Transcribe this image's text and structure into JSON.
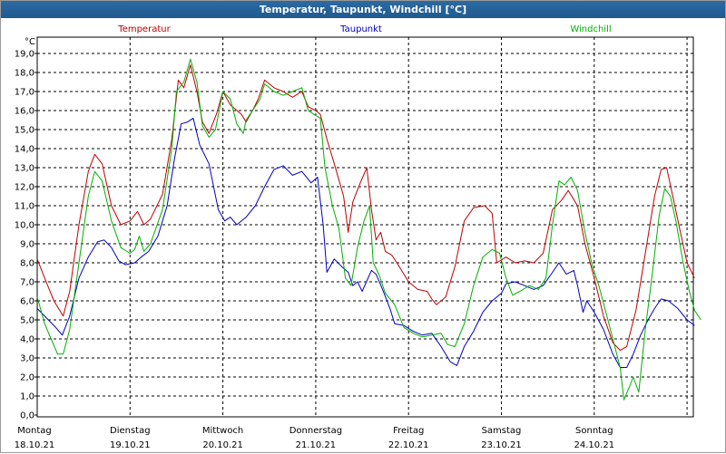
{
  "window": {
    "title": "Temperatur, Taupunkt, Windchill [°C]"
  },
  "chart_data": {
    "type": "line",
    "title": "Temperatur, Taupunkt, Windchill [°C]",
    "ylabel": "°C",
    "ylim": [
      0,
      19.5
    ],
    "xlim": [
      0,
      7
    ],
    "grid": true,
    "legend": "top",
    "yticks": [
      "0,0",
      "1,0",
      "2,0",
      "3,0",
      "4,0",
      "5,0",
      "6,0",
      "7,0",
      "8,0",
      "9,0",
      "10,0",
      "11,0",
      "12,0",
      "13,0",
      "14,0",
      "15,0",
      "16,0",
      "17,0",
      "18,0",
      "19,0"
    ],
    "xticks": [
      {
        "day": "Montag",
        "date": "18.10.21"
      },
      {
        "day": "Dienstag",
        "date": "19.10.21"
      },
      {
        "day": "Mittwoch",
        "date": "20.10.21"
      },
      {
        "day": "Donnerstag",
        "date": "21.10.21"
      },
      {
        "day": "Freitag",
        "date": "22.10.21"
      },
      {
        "day": "Samstag",
        "date": "23.10.21"
      },
      {
        "day": "Sonntag",
        "date": "24.10.21"
      }
    ],
    "series": [
      {
        "name": "Temperatur",
        "color": "#c00000",
        "points": [
          [
            0.0,
            8.2
          ],
          [
            0.08,
            7.2
          ],
          [
            0.18,
            6.0
          ],
          [
            0.28,
            5.2
          ],
          [
            0.35,
            6.5
          ],
          [
            0.45,
            10.0
          ],
          [
            0.55,
            12.8
          ],
          [
            0.62,
            13.7
          ],
          [
            0.7,
            13.2
          ],
          [
            0.8,
            11.0
          ],
          [
            0.9,
            10.0
          ],
          [
            1.0,
            10.2
          ],
          [
            1.08,
            10.7
          ],
          [
            1.15,
            10.0
          ],
          [
            1.22,
            10.3
          ],
          [
            1.35,
            11.6
          ],
          [
            1.45,
            14.5
          ],
          [
            1.52,
            17.6
          ],
          [
            1.58,
            17.2
          ],
          [
            1.65,
            18.4
          ],
          [
            1.72,
            17.0
          ],
          [
            1.78,
            15.4
          ],
          [
            1.85,
            14.8
          ],
          [
            1.93,
            15.8
          ],
          [
            2.0,
            17.0
          ],
          [
            2.08,
            16.3
          ],
          [
            2.2,
            15.8
          ],
          [
            2.25,
            15.4
          ],
          [
            2.32,
            16.0
          ],
          [
            2.38,
            16.6
          ],
          [
            2.45,
            17.6
          ],
          [
            2.55,
            17.2
          ],
          [
            2.65,
            17.0
          ],
          [
            2.75,
            16.7
          ],
          [
            2.85,
            17.0
          ],
          [
            2.92,
            16.2
          ],
          [
            3.0,
            16.0
          ],
          [
            3.05,
            15.8
          ],
          [
            3.12,
            14.5
          ],
          [
            3.2,
            13.2
          ],
          [
            3.3,
            11.5
          ],
          [
            3.35,
            9.6
          ],
          [
            3.4,
            11.2
          ],
          [
            3.48,
            12.2
          ],
          [
            3.55,
            13.0
          ],
          [
            3.6,
            10.8
          ],
          [
            3.65,
            9.2
          ],
          [
            3.7,
            9.6
          ],
          [
            3.75,
            8.6
          ],
          [
            3.82,
            8.4
          ],
          [
            3.9,
            7.8
          ],
          [
            4.0,
            7.0
          ],
          [
            4.1,
            6.6
          ],
          [
            4.2,
            6.5
          ],
          [
            4.25,
            6.1
          ],
          [
            4.3,
            5.8
          ],
          [
            4.4,
            6.2
          ],
          [
            4.5,
            7.8
          ],
          [
            4.6,
            10.2
          ],
          [
            4.7,
            10.9
          ],
          [
            4.82,
            11.0
          ],
          [
            4.9,
            10.6
          ],
          [
            4.95,
            8.0
          ],
          [
            5.05,
            8.3
          ],
          [
            5.15,
            8.0
          ],
          [
            5.25,
            8.1
          ],
          [
            5.35,
            8.0
          ],
          [
            5.45,
            8.5
          ],
          [
            5.55,
            10.8
          ],
          [
            5.65,
            11.3
          ],
          [
            5.72,
            11.8
          ],
          [
            5.82,
            11.0
          ],
          [
            5.9,
            9.0
          ],
          [
            6.0,
            7.2
          ],
          [
            6.1,
            5.2
          ],
          [
            6.2,
            3.8
          ],
          [
            6.28,
            3.4
          ],
          [
            6.35,
            3.6
          ],
          [
            6.45,
            5.5
          ],
          [
            6.55,
            8.5
          ],
          [
            6.65,
            11.5
          ],
          [
            6.72,
            12.9
          ],
          [
            6.78,
            13.0
          ],
          [
            6.85,
            11.4
          ],
          [
            6.92,
            9.8
          ],
          [
            7.0,
            8.0
          ],
          [
            7.08,
            7.2
          ]
        ]
      },
      {
        "name": "Taupunkt",
        "color": "#0000c0",
        "points": [
          [
            0.0,
            5.6
          ],
          [
            0.1,
            5.1
          ],
          [
            0.2,
            4.6
          ],
          [
            0.27,
            4.2
          ],
          [
            0.35,
            5.2
          ],
          [
            0.45,
            7.2
          ],
          [
            0.55,
            8.3
          ],
          [
            0.65,
            9.1
          ],
          [
            0.72,
            9.2
          ],
          [
            0.8,
            8.8
          ],
          [
            0.88,
            8.1
          ],
          [
            0.95,
            7.9
          ],
          [
            1.05,
            8.0
          ],
          [
            1.12,
            8.3
          ],
          [
            1.2,
            8.6
          ],
          [
            1.3,
            9.4
          ],
          [
            1.4,
            11.0
          ],
          [
            1.48,
            13.5
          ],
          [
            1.55,
            15.3
          ],
          [
            1.62,
            15.4
          ],
          [
            1.68,
            15.6
          ],
          [
            1.75,
            14.2
          ],
          [
            1.85,
            13.2
          ],
          [
            1.95,
            10.8
          ],
          [
            2.02,
            10.2
          ],
          [
            2.08,
            10.4
          ],
          [
            2.15,
            10.0
          ],
          [
            2.25,
            10.4
          ],
          [
            2.35,
            11.0
          ],
          [
            2.45,
            12.0
          ],
          [
            2.55,
            12.9
          ],
          [
            2.65,
            13.1
          ],
          [
            2.75,
            12.6
          ],
          [
            2.85,
            12.8
          ],
          [
            2.95,
            12.2
          ],
          [
            3.02,
            12.5
          ],
          [
            3.08,
            10.0
          ],
          [
            3.12,
            7.5
          ],
          [
            3.2,
            8.2
          ],
          [
            3.28,
            7.8
          ],
          [
            3.35,
            7.5
          ],
          [
            3.4,
            6.8
          ],
          [
            3.45,
            7.0
          ],
          [
            3.5,
            6.5
          ],
          [
            3.6,
            7.6
          ],
          [
            3.65,
            7.4
          ],
          [
            3.72,
            6.6
          ],
          [
            3.8,
            5.6
          ],
          [
            3.85,
            4.8
          ],
          [
            3.95,
            4.7
          ],
          [
            4.05,
            4.4
          ],
          [
            4.15,
            4.2
          ],
          [
            4.25,
            4.3
          ],
          [
            4.35,
            3.6
          ],
          [
            4.45,
            2.8
          ],
          [
            4.52,
            2.6
          ],
          [
            4.6,
            3.6
          ],
          [
            4.7,
            4.4
          ],
          [
            4.8,
            5.4
          ],
          [
            4.9,
            6.0
          ],
          [
            5.0,
            6.4
          ],
          [
            5.05,
            6.9
          ],
          [
            5.15,
            7.0
          ],
          [
            5.25,
            6.8
          ],
          [
            5.35,
            6.6
          ],
          [
            5.45,
            6.8
          ],
          [
            5.55,
            7.5
          ],
          [
            5.62,
            8.0
          ],
          [
            5.7,
            7.4
          ],
          [
            5.78,
            7.6
          ],
          [
            5.82,
            6.8
          ],
          [
            5.88,
            5.4
          ],
          [
            5.92,
            6.0
          ],
          [
            6.0,
            5.4
          ],
          [
            6.1,
            4.5
          ],
          [
            6.2,
            3.2
          ],
          [
            6.28,
            2.5
          ],
          [
            6.35,
            2.5
          ],
          [
            6.42,
            3.2
          ],
          [
            6.5,
            4.2
          ],
          [
            6.58,
            5.0
          ],
          [
            6.65,
            5.6
          ],
          [
            6.72,
            6.1
          ],
          [
            6.8,
            6.0
          ],
          [
            6.9,
            5.6
          ],
          [
            7.0,
            5.0
          ],
          [
            7.08,
            4.7
          ]
        ]
      },
      {
        "name": "Windchill",
        "color": "#00b000",
        "points": [
          [
            0.0,
            6.2
          ],
          [
            0.08,
            4.8
          ],
          [
            0.15,
            4.0
          ],
          [
            0.22,
            3.2
          ],
          [
            0.28,
            3.2
          ],
          [
            0.35,
            4.5
          ],
          [
            0.45,
            8.0
          ],
          [
            0.55,
            11.5
          ],
          [
            0.62,
            12.8
          ],
          [
            0.7,
            12.3
          ],
          [
            0.8,
            10.2
          ],
          [
            0.9,
            8.8
          ],
          [
            1.0,
            8.5
          ],
          [
            1.05,
            8.7
          ],
          [
            1.1,
            9.4
          ],
          [
            1.15,
            8.6
          ],
          [
            1.22,
            9.0
          ],
          [
            1.35,
            10.8
          ],
          [
            1.45,
            14.0
          ],
          [
            1.5,
            17.0
          ],
          [
            1.58,
            17.5
          ],
          [
            1.65,
            18.7
          ],
          [
            1.72,
            17.5
          ],
          [
            1.78,
            15.2
          ],
          [
            1.85,
            14.6
          ],
          [
            1.92,
            15.0
          ],
          [
            2.0,
            17.0
          ],
          [
            2.08,
            16.6
          ],
          [
            2.15,
            15.3
          ],
          [
            2.22,
            14.8
          ],
          [
            2.25,
            15.5
          ],
          [
            2.32,
            16.0
          ],
          [
            2.4,
            16.6
          ],
          [
            2.45,
            17.4
          ],
          [
            2.55,
            17.0
          ],
          [
            2.65,
            16.8
          ],
          [
            2.75,
            17.0
          ],
          [
            2.85,
            17.2
          ],
          [
            2.92,
            16.0
          ],
          [
            2.98,
            15.8
          ],
          [
            3.05,
            15.6
          ],
          [
            3.1,
            13.0
          ],
          [
            3.18,
            11.0
          ],
          [
            3.25,
            9.8
          ],
          [
            3.32,
            7.2
          ],
          [
            3.38,
            6.8
          ],
          [
            3.45,
            8.8
          ],
          [
            3.52,
            10.2
          ],
          [
            3.58,
            11.0
          ],
          [
            3.62,
            8.0
          ],
          [
            3.68,
            7.4
          ],
          [
            3.75,
            6.4
          ],
          [
            3.85,
            5.8
          ],
          [
            3.95,
            4.6
          ],
          [
            4.05,
            4.3
          ],
          [
            4.15,
            4.1
          ],
          [
            4.25,
            4.2
          ],
          [
            4.35,
            4.3
          ],
          [
            4.42,
            3.7
          ],
          [
            4.5,
            3.6
          ],
          [
            4.6,
            4.8
          ],
          [
            4.7,
            6.8
          ],
          [
            4.8,
            8.3
          ],
          [
            4.9,
            8.7
          ],
          [
            4.98,
            8.5
          ],
          [
            5.05,
            7.2
          ],
          [
            5.12,
            6.3
          ],
          [
            5.2,
            6.5
          ],
          [
            5.3,
            6.8
          ],
          [
            5.4,
            6.6
          ],
          [
            5.48,
            7.2
          ],
          [
            5.55,
            10.0
          ],
          [
            5.62,
            12.3
          ],
          [
            5.68,
            12.1
          ],
          [
            5.75,
            12.5
          ],
          [
            5.82,
            11.8
          ],
          [
            5.9,
            9.6
          ],
          [
            5.98,
            7.8
          ],
          [
            6.05,
            6.8
          ],
          [
            6.12,
            5.5
          ],
          [
            6.2,
            4.0
          ],
          [
            6.28,
            2.5
          ],
          [
            6.32,
            0.8
          ],
          [
            6.38,
            1.5
          ],
          [
            6.42,
            2.0
          ],
          [
            6.48,
            1.2
          ],
          [
            6.55,
            4.5
          ],
          [
            6.62,
            7.2
          ],
          [
            6.7,
            10.5
          ],
          [
            6.76,
            11.9
          ],
          [
            6.82,
            11.5
          ],
          [
            6.88,
            10.2
          ],
          [
            6.95,
            8.2
          ],
          [
            7.02,
            6.6
          ],
          [
            7.08,
            5.5
          ],
          [
            7.15,
            5.0
          ]
        ]
      }
    ]
  }
}
